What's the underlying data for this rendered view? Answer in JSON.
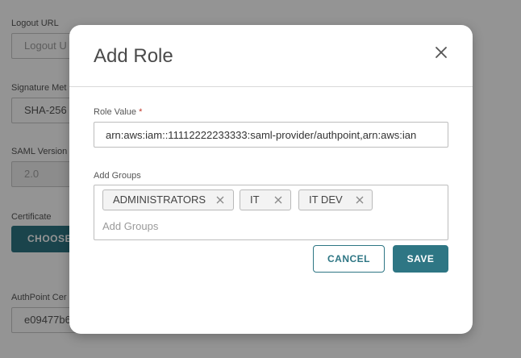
{
  "background_form": {
    "logout_url": {
      "label": "Logout URL",
      "placeholder": "Logout U"
    },
    "signature_method": {
      "label": "Signature Met",
      "value": "SHA-256"
    },
    "saml_version": {
      "label": "SAML Version",
      "value": "2.0"
    },
    "certificate": {
      "label": "Certificate",
      "button_label": "CHOOSE"
    },
    "authpoint_certificate": {
      "label": "AuthPoint Cer",
      "value": "e09477b6"
    }
  },
  "modal": {
    "title": "Add Role",
    "close_icon": "close-icon",
    "role_value": {
      "label": "Role Value",
      "required_marker": "*",
      "value": "arn:aws:iam::11112222233333:saml-provider/authpoint,arn:aws:ian"
    },
    "add_groups": {
      "label": "Add Groups",
      "placeholder": "Add Groups",
      "chips": [
        {
          "label": "ADMINISTRATORS"
        },
        {
          "label": "IT"
        },
        {
          "label": "IT DEV"
        }
      ],
      "remove_icon": "close-icon"
    },
    "cancel_label": "CANCEL",
    "save_label": "SAVE"
  },
  "colors": {
    "accent": "#2e7684",
    "required": "#c0392b",
    "overlay": "rgba(0,0,0,0.42)"
  }
}
